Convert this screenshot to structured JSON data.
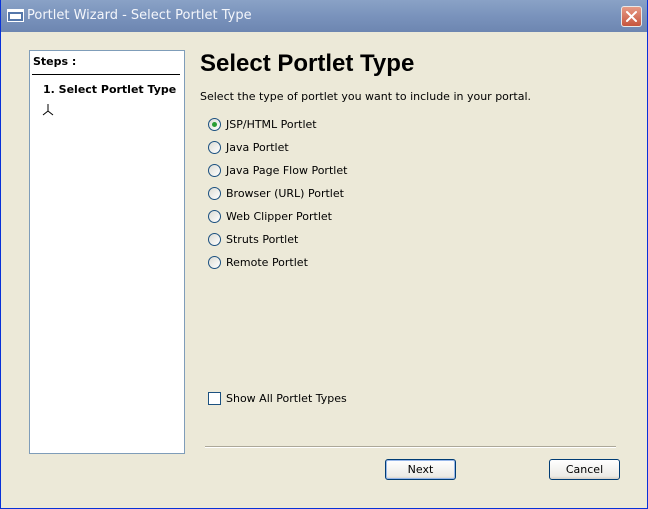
{
  "window": {
    "title": "Portlet Wizard - Select Portlet Type"
  },
  "steps": {
    "header": "Steps :",
    "items": [
      {
        "label": "1. Select Portlet Type",
        "current": true
      }
    ]
  },
  "main": {
    "title": "Select Portlet Type",
    "description": "Select the type of portlet you want to include in your portal.",
    "portlet_types": [
      {
        "label": "JSP/HTML Portlet",
        "selected": true
      },
      {
        "label": "Java Portlet",
        "selected": false
      },
      {
        "label": "Java Page Flow Portlet",
        "selected": false
      },
      {
        "label": "Browser (URL) Portlet",
        "selected": false
      },
      {
        "label": "Web Clipper Portlet",
        "selected": false
      },
      {
        "label": "Struts Portlet",
        "selected": false
      },
      {
        "label": "Remote Portlet",
        "selected": false
      }
    ],
    "show_all": {
      "label": "Show All Portlet Types",
      "checked": false
    }
  },
  "buttons": {
    "next": "Next",
    "cancel": "Cancel"
  }
}
